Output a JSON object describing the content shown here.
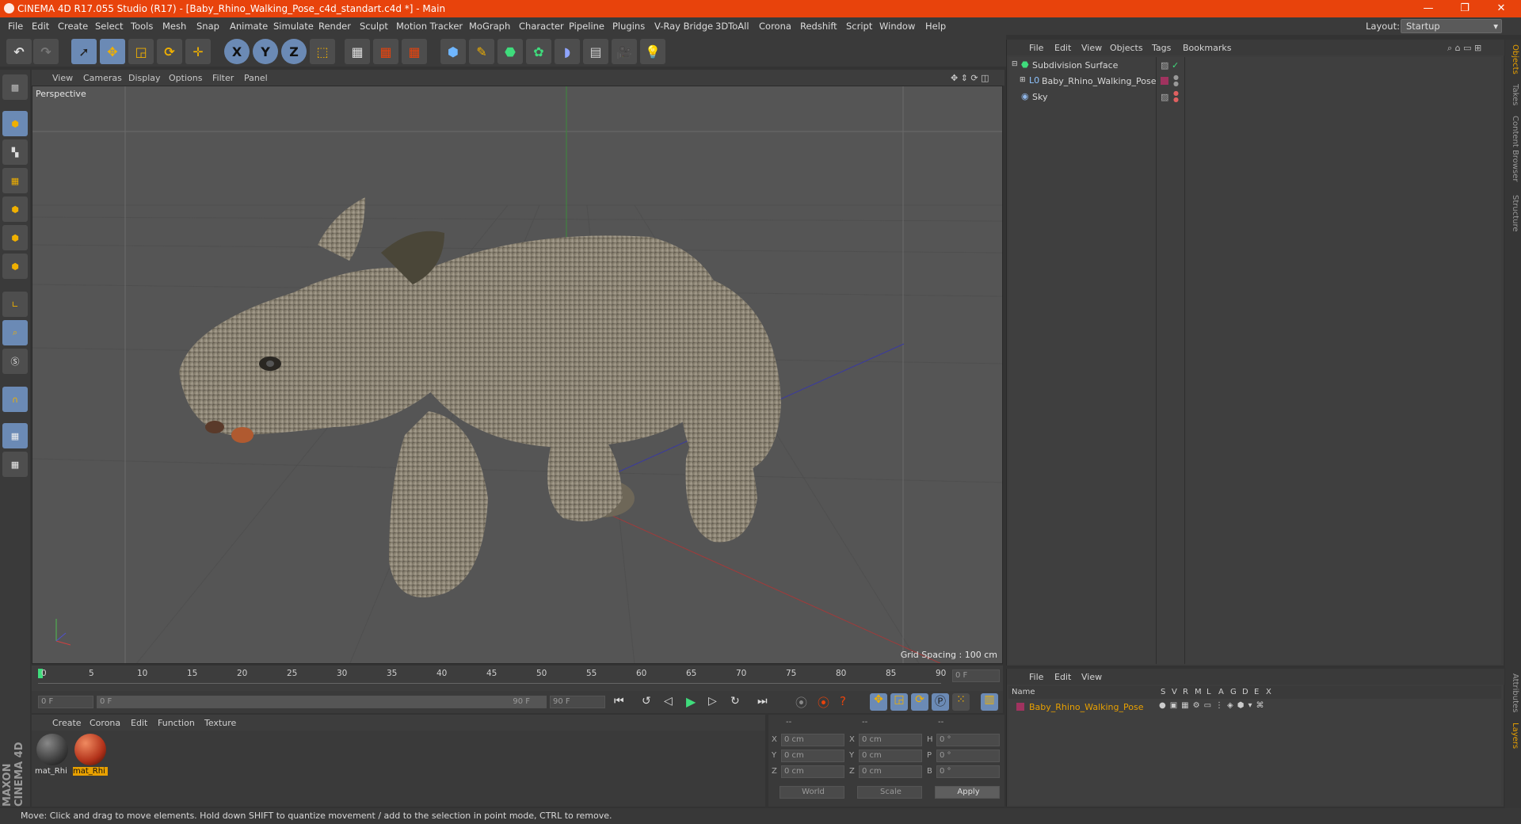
{
  "window": {
    "title": "CINEMA 4D R17.055 Studio (R17) - [Baby_Rhino_Walking_Pose_c4d_standart.c4d *] - Main",
    "min": "—",
    "max": "❐",
    "close": "✕"
  },
  "menubar": {
    "items": [
      "File",
      "Edit",
      "Create",
      "Select",
      "Tools",
      "Mesh",
      "Snap",
      "Animate",
      "Simulate",
      "Render",
      "Sculpt",
      "Motion Tracker",
      "MoGraph",
      "Character",
      "Pipeline",
      "Plugins",
      "V-Ray Bridge",
      "3DToAll",
      "Corona",
      "Redshift",
      "Script",
      "Window",
      "Help"
    ],
    "layout_label": "Layout:",
    "layout_value": "Startup"
  },
  "toolbar": {
    "axis_x": "X",
    "axis_y": "Y",
    "axis_z": "Z"
  },
  "viewport": {
    "menu": [
      "View",
      "Cameras",
      "Display",
      "Options",
      "Filter",
      "Panel"
    ],
    "name": "Perspective",
    "grid_spacing": "Grid Spacing : 100 cm"
  },
  "timeline": {
    "ticks": [
      "0",
      "5",
      "10",
      "15",
      "20",
      "25",
      "30",
      "35",
      "40",
      "45",
      "50",
      "55",
      "60",
      "65",
      "70",
      "75",
      "80",
      "85",
      "90"
    ],
    "current": "0 F"
  },
  "transport": {
    "start": "0 F",
    "range_start": "0 F",
    "range_end": "90 F",
    "end": "90 F"
  },
  "materials": {
    "menu": [
      "Create",
      "Corona",
      "Edit",
      "Function",
      "Texture"
    ],
    "items": [
      {
        "name": "mat_Rhi",
        "color": "#3d3d3d"
      },
      {
        "name": "mat_Rhi",
        "color": "#b2321a"
      }
    ]
  },
  "coords": {
    "header": [
      "--",
      "--",
      "--"
    ],
    "rows": [
      {
        "a": "X",
        "av": "0 cm",
        "b": "X",
        "bv": "0 cm",
        "c": "H",
        "cv": "0 °"
      },
      {
        "a": "Y",
        "av": "0 cm",
        "b": "Y",
        "bv": "0 cm",
        "c": "P",
        "cv": "0 °"
      },
      {
        "a": "Z",
        "av": "0 cm",
        "b": "Z",
        "bv": "0 cm",
        "c": "B",
        "cv": "0 °"
      }
    ],
    "mode": "World",
    "scale": "Scale",
    "apply": "Apply"
  },
  "objects": {
    "menu": [
      "File",
      "Edit",
      "View",
      "Objects",
      "Tags",
      "Bookmarks"
    ],
    "items": [
      {
        "name": "Subdivision Surface"
      },
      {
        "name": "Baby_Rhino_Walking_Pose"
      },
      {
        "name": "Sky"
      }
    ]
  },
  "layers": {
    "menu": [
      "File",
      "Edit",
      "View"
    ],
    "columns": [
      "Name",
      "S",
      "V",
      "R",
      "M",
      "L",
      "A",
      "G",
      "D",
      "E",
      "X"
    ],
    "rows": [
      {
        "name": "Baby_Rhino_Walking_Pose",
        "color": "#a0335f"
      }
    ]
  },
  "sidetabs": [
    "Objects",
    "Takes",
    "Content Browser",
    "Structure",
    "Attributes",
    "Layers"
  ],
  "brand": "MAXON CINEMA 4D",
  "status": "Move: Click and drag to move elements. Hold down SHIFT to quantize movement / add to the selection in point mode, CTRL to remove.",
  "colors": {
    "accent": "#e8430c",
    "active_tool": "#6b8ab5",
    "layer_text": "#e8a000"
  }
}
